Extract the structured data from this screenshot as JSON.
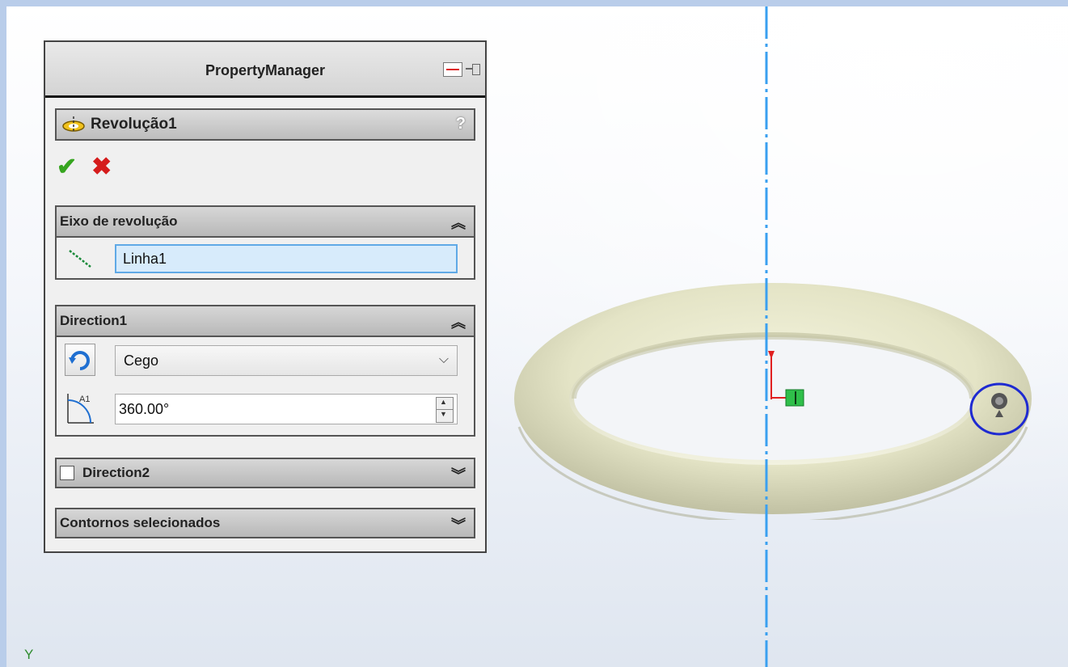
{
  "property_manager": {
    "title": "PropertyManager",
    "feature": {
      "name": "Revolução1",
      "help": "?"
    },
    "axis_group": {
      "title": "Eixo de revolução",
      "value": "Linha1"
    },
    "direction1": {
      "title": "Direction1",
      "type": "Cego",
      "angle": "360.00°"
    },
    "direction2": {
      "title": "Direction2",
      "checked": false
    },
    "contours": {
      "title": "Contornos selecionados"
    }
  },
  "viewport": {
    "axis_label": "Y",
    "part_color": "#e6e6c8",
    "axis_color": "#3aa0f0"
  },
  "icons": {
    "feature": "revolve-icon",
    "ok": "checkmark-icon",
    "cancel": "close-icon",
    "axis": "line-icon",
    "direction": "reverse-direction-icon",
    "angle": "angle-icon"
  }
}
